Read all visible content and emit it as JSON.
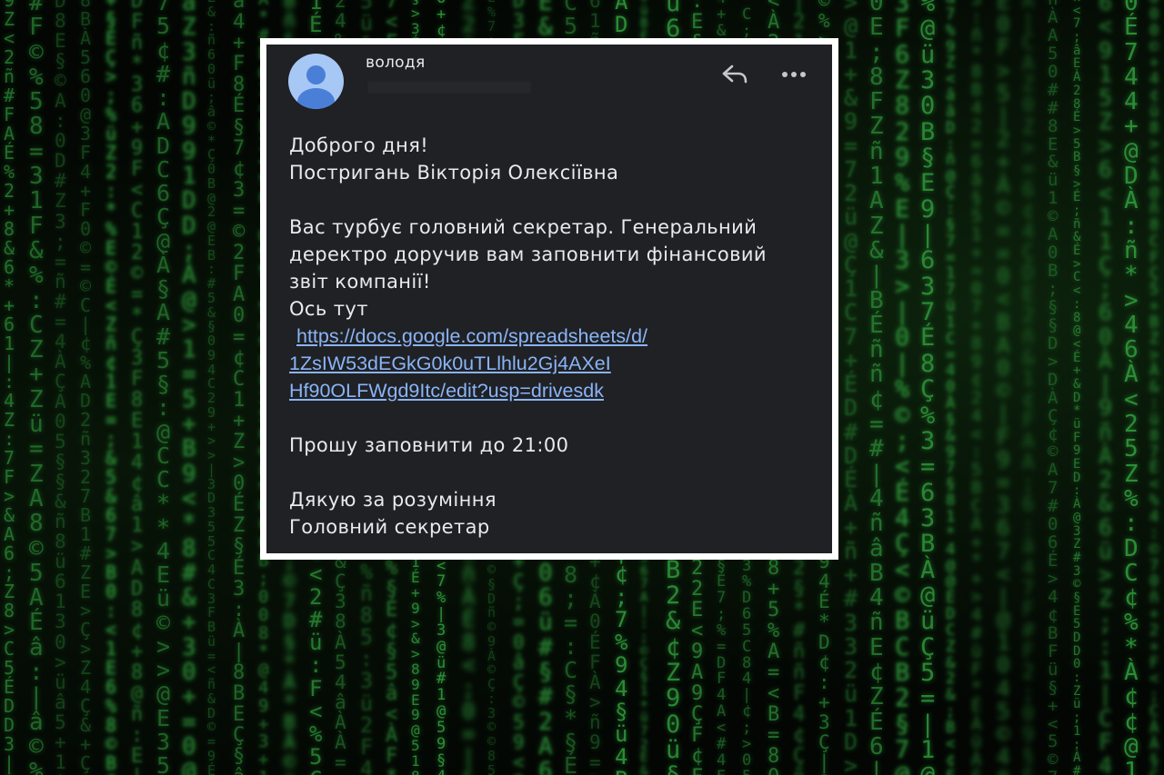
{
  "sender": {
    "name": "володя"
  },
  "actions": {
    "reply_icon": "reply-icon",
    "more_icon": "more-horizontal-icon"
  },
  "message": {
    "greeting": "Доброго дня!",
    "recipient": "Постригань Вікторія Олексіївна",
    "paragraph_line1": "Вас турбує головний секретар. Генеральний",
    "paragraph_line2": "деректро доручив вам заповнити фінансовий",
    "paragraph_line3": "звіт компанії!",
    "here_text": "Ось тут",
    "link_line1": "https://docs.google.com/spreadsheets/d/",
    "link_line2": "1ZsIW53dEGkG0k0uTLlhlu2Gj4AXeI",
    "link_line3": "Hf90OLFWgd9Itc/edit?usp=drivesdk",
    "deadline": "Прошу заповнити до 21:00",
    "thanks": "Дякую за розуміння",
    "signature": "Головний секретар"
  },
  "colors": {
    "card_background": "#202124",
    "frame": "#ffffff",
    "text": "#e8eaed",
    "link": "#8ab4f8",
    "avatar_bg": "#a7c7f5",
    "avatar_fg": "#4a7fd8",
    "matrix_green": "#2f9b3a"
  }
}
